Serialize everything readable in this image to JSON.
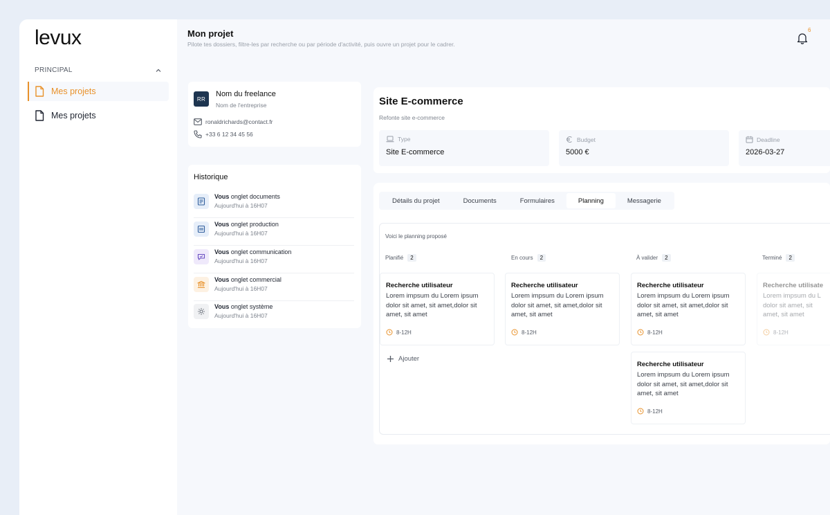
{
  "sidebar": {
    "logo": "levux",
    "section_label": "PRINCIPAL",
    "items": [
      {
        "label": "Mes projets",
        "active": true
      },
      {
        "label": "Mes projets",
        "active": false
      }
    ]
  },
  "header": {
    "title": "Mon projet",
    "subtitle": "Pilote tes dossiers, filtre-les par recherche ou par période d'activité, puis ouvre un projet pour le cadrer.",
    "notification_count": "6"
  },
  "freelance": {
    "initials": "RR",
    "name": "Nom du freelance",
    "company": "Nom de l'entreprise",
    "email": "ronaldrichards@contact.fr",
    "phone": "+33 6 12 34 45 56"
  },
  "history": {
    "title": "Historique",
    "items": [
      {
        "actor": "Vous",
        "action": "onglet documents",
        "time": "Aujourd'hui à 16H07",
        "icon": "document-icon"
      },
      {
        "actor": "Vous",
        "action": "onglet production",
        "time": "Aujourd'hui à 16H07",
        "icon": "production-icon"
      },
      {
        "actor": "Vous",
        "action": "onglet communication",
        "time": "Aujourd'hui à 16H07",
        "icon": "communication-icon"
      },
      {
        "actor": "Vous",
        "action": "onglet commercial",
        "time": "Aujourd'hui à 16H07",
        "icon": "bank-icon"
      },
      {
        "actor": "Vous",
        "action": "onglet système",
        "time": "Aujourd'hui à 16H07",
        "icon": "gear-icon"
      }
    ]
  },
  "project": {
    "title": "Site E-commerce",
    "subtitle": "Refonte site e-commerce",
    "stats": [
      {
        "label": "Type",
        "value": "Site E-commerce",
        "icon": "laptop-icon"
      },
      {
        "label": "Budget",
        "value": "5000 €",
        "icon": "euro-icon"
      },
      {
        "label": "Deadline",
        "value": "2026-03-27",
        "icon": "calendar-icon"
      }
    ]
  },
  "tabs": [
    {
      "label": "Détails du projet",
      "active": false
    },
    {
      "label": "Documents",
      "active": false
    },
    {
      "label": "Formulaires",
      "active": false
    },
    {
      "label": "Planning",
      "active": true
    },
    {
      "label": "Messagerie",
      "active": false
    }
  ],
  "planning": {
    "intro": "Voici le planning proposé",
    "add_label": "Ajouter",
    "columns": [
      {
        "title": "Planifié",
        "count": "2"
      },
      {
        "title": "En cours",
        "count": "2"
      },
      {
        "title": "À valider",
        "count": "2"
      },
      {
        "title": "Terminé",
        "count": "2"
      }
    ],
    "task": {
      "title": "Recherche utilisateur",
      "description": "Lorem impsum du Lorem ipsum dolor sit amet, sit amet,dolor sit amet, sit amet",
      "time": "8-12H"
    },
    "task_partial": {
      "title": "Recherche utilisate",
      "description_lines": [
        "Lorem impsum du L",
        "dolor sit amet, sit",
        "amet, sit amet"
      ]
    }
  },
  "colors": {
    "accent": "#e8912a",
    "avatar": "#1e3550",
    "background": "#e8eef7"
  }
}
